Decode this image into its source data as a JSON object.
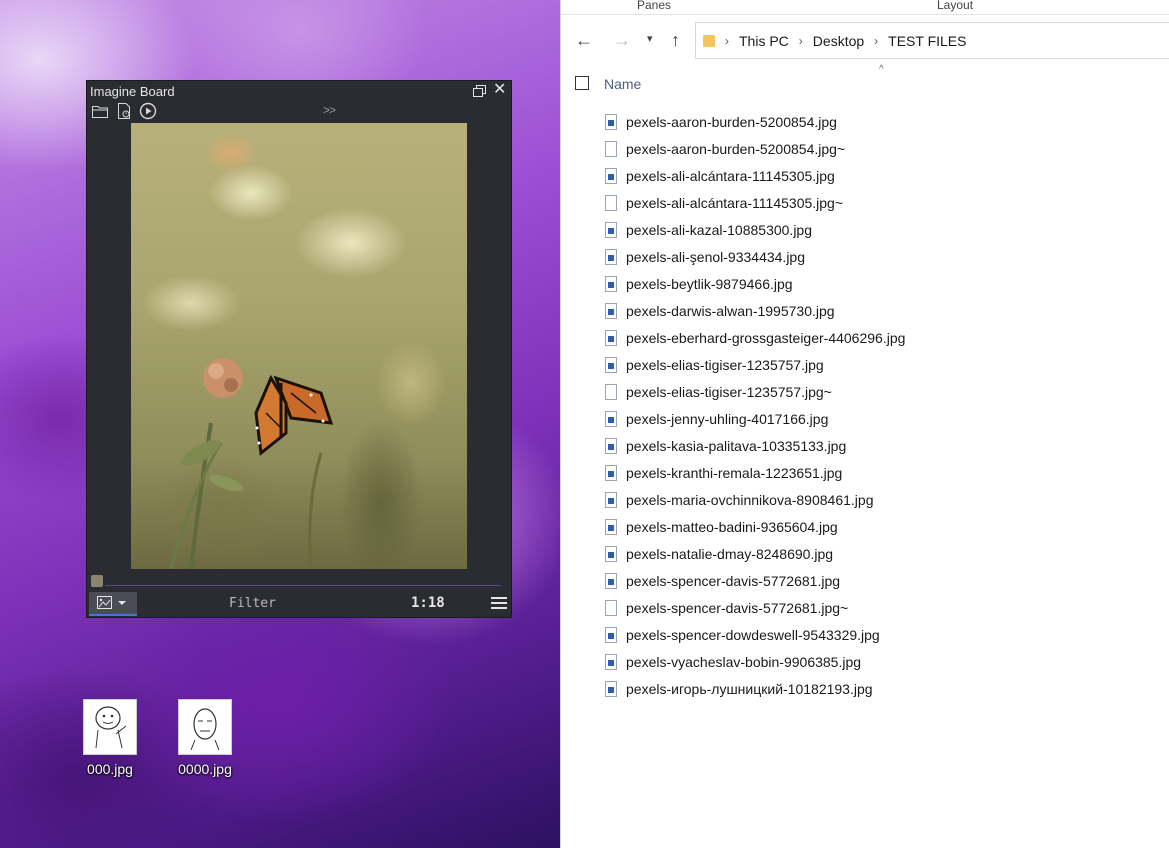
{
  "desktop": {
    "icons": [
      {
        "label": "000.jpg"
      },
      {
        "label": "0000.jpg"
      }
    ]
  },
  "imagine_board": {
    "title": "Imagine Board",
    "more_label": ">>",
    "filter_label": "Filter",
    "zoom": "1:18",
    "image_subject": "monarch butterfly on clover"
  },
  "explorer": {
    "ribbon": {
      "panes_label": "Panes",
      "layout_label": "Layout"
    },
    "breadcrumb": [
      "This PC",
      "Desktop",
      "TEST FILES"
    ],
    "column_name": "Name",
    "files": [
      {
        "name": "pexels-aaron-burden-5200854.jpg",
        "type": "image"
      },
      {
        "name": "pexels-aaron-burden-5200854.jpg~",
        "type": "blank"
      },
      {
        "name": "pexels-ali-alcántara-11145305.jpg",
        "type": "image"
      },
      {
        "name": "pexels-ali-alcántara-11145305.jpg~",
        "type": "blank"
      },
      {
        "name": "pexels-ali-kazal-10885300.jpg",
        "type": "image"
      },
      {
        "name": "pexels-ali-şenol-9334434.jpg",
        "type": "image"
      },
      {
        "name": "pexels-beytlik-9879466.jpg",
        "type": "image"
      },
      {
        "name": "pexels-darwis-alwan-1995730.jpg",
        "type": "image"
      },
      {
        "name": "pexels-eberhard-grossgasteiger-4406296.jpg",
        "type": "image"
      },
      {
        "name": "pexels-elias-tigiser-1235757.jpg",
        "type": "image"
      },
      {
        "name": "pexels-elias-tigiser-1235757.jpg~",
        "type": "blank"
      },
      {
        "name": "pexels-jenny-uhling-4017166.jpg",
        "type": "image"
      },
      {
        "name": "pexels-kasia-palitava-10335133.jpg",
        "type": "image"
      },
      {
        "name": "pexels-kranthi-remala-1223651.jpg",
        "type": "image"
      },
      {
        "name": "pexels-maria-ovchinnikova-8908461.jpg",
        "type": "image"
      },
      {
        "name": "pexels-matteo-badini-9365604.jpg",
        "type": "image"
      },
      {
        "name": "pexels-natalie-dmay-8248690.jpg",
        "type": "image"
      },
      {
        "name": "pexels-spencer-davis-5772681.jpg",
        "type": "image"
      },
      {
        "name": "pexels-spencer-davis-5772681.jpg~",
        "type": "blank"
      },
      {
        "name": "pexels-spencer-dowdeswell-9543329.jpg",
        "type": "image"
      },
      {
        "name": "pexels-vyacheslav-bobin-9906385.jpg",
        "type": "image"
      },
      {
        "name": "pexels-игорь-лушницкий-10182193.jpg",
        "type": "image"
      }
    ]
  }
}
